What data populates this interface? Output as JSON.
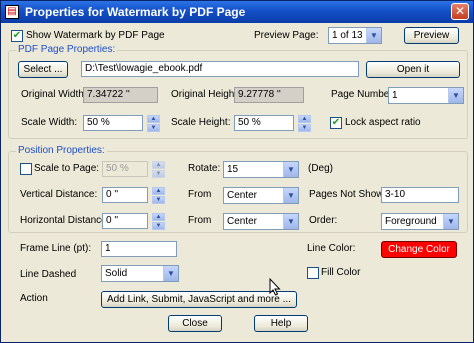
{
  "window": {
    "title": "Properties for Watermark by PDF Page",
    "close_glyph": "✕",
    "icon": "pdf-app-icon"
  },
  "top": {
    "show_watermark_label": "Show Watermark by PDF Page",
    "show_watermark_checked": true,
    "preview_page_label": "Preview Page:",
    "preview_page_value": "1 of 13",
    "preview_button": "Preview"
  },
  "pdf_props": {
    "title": "PDF Page Properties:",
    "select_button": "Select ...",
    "file_path": "D:\\Test\\lowagie_ebook.pdf",
    "open_button": "Open it",
    "original_width_label": "Original Width:",
    "original_width_value": "7.34722 ''",
    "original_height_label": "Original Height:",
    "original_height_value": "9.27778 ''",
    "page_number_label": "Page Number",
    "page_number_value": "1",
    "scale_width_label": "Scale Width:",
    "scale_width_value": "50 %",
    "scale_height_label": "Scale Height:",
    "scale_height_value": "50 %",
    "lock_aspect_label": "Lock aspect ratio",
    "lock_aspect_checked": true
  },
  "position": {
    "title": "Position Properties:",
    "scale_to_page_label": "Scale to Page:",
    "scale_to_page_checked": false,
    "scale_to_page_value": "50 %",
    "rotate_label": "Rotate:",
    "rotate_value": "15",
    "rotate_unit": "(Deg)",
    "vertical_distance_label": "Vertical Distance:",
    "vertical_distance_value": "0 ''",
    "vertical_from_label": "From",
    "vertical_from_value": "Center",
    "pages_not_shown_label": "Pages Not Shown:",
    "pages_not_shown_value": "3-10",
    "horizontal_distance_label": "Horizontal Distance:",
    "horizontal_distance_value": "0 ''",
    "horizontal_from_label": "From",
    "horizontal_from_value": "Center",
    "order_label": "Order:",
    "order_value": "Foreground"
  },
  "frame": {
    "frame_line_label": "Frame Line (pt):",
    "frame_line_value": "1",
    "line_color_label": "Line Color:",
    "change_color_button": "Change Color",
    "line_color_hex": "#ff0000",
    "line_dashed_label": "Line Dashed",
    "line_dashed_value": "Solid",
    "fill_color_label": "Fill Color",
    "fill_color_checked": false,
    "action_label": "Action",
    "action_button": "Add Link, Submit, JavaScript and more ..."
  },
  "footer": {
    "close_button": "Close",
    "help_button": "Help"
  }
}
